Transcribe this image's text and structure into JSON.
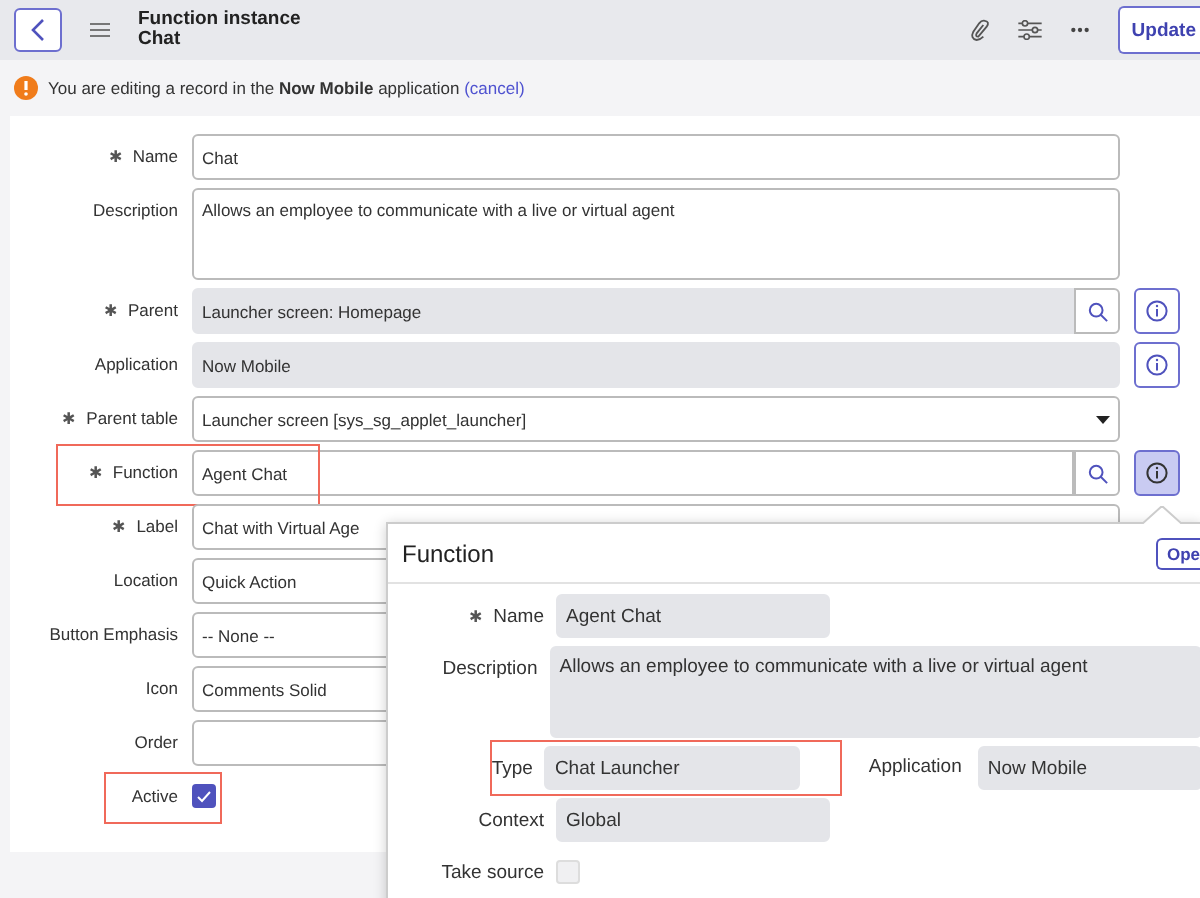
{
  "header": {
    "title": "Function instance",
    "subtitle": "Chat",
    "update_button": "Update"
  },
  "notice": {
    "before": "You are editing a record in the",
    "app": "Now Mobile",
    "after": "application",
    "link": "(cancel)"
  },
  "form": {
    "rows": [
      {
        "label": "Name",
        "marker": "✱",
        "kind": "text",
        "value": "Chat",
        "highlighted": false
      },
      {
        "label": "Description",
        "kind": "textarea",
        "value": "Allows an employee to communicate with a live or virtual agent",
        "highlighted": false
      },
      {
        "label": "Parent",
        "marker": "✱",
        "kind": "reference-readonly",
        "value": "Launcher screen: Homepage",
        "info_button": {
          "pressed": false
        },
        "highlighted": false
      },
      {
        "label": "Application",
        "kind": "readonly",
        "value": "Now Mobile",
        "info_button": {
          "pressed": false
        },
        "highlighted": false
      },
      {
        "label": "Parent table",
        "marker": "✱",
        "kind": "select",
        "value": "Launcher screen [sys_sg_applet_launcher]",
        "highlighted": false
      },
      {
        "label": "Function",
        "marker": "✱",
        "kind": "reference",
        "value": "Agent Chat",
        "info_button": {
          "pressed": true
        },
        "highlighted": true
      },
      {
        "label": "Label",
        "marker": "✱",
        "kind": "text",
        "value": "Chat with Virtual Age",
        "highlighted": false
      },
      {
        "label": "Location",
        "kind": "text",
        "value": "Quick Action",
        "highlighted": false
      },
      {
        "label": "Button Emphasis",
        "kind": "text",
        "value": "-- None --",
        "highlighted": false
      },
      {
        "label": "Icon",
        "kind": "text",
        "value": "Comments Solid",
        "highlighted": false
      },
      {
        "label": "Order",
        "kind": "text",
        "value": "",
        "highlighted": false
      },
      {
        "label": "Active",
        "kind": "checkbox",
        "checked": true,
        "highlighted": true
      }
    ]
  },
  "popup": {
    "title": "Function",
    "open_button": "Ope",
    "fields": [
      {
        "label": "Name",
        "marker": "✱",
        "kind": "short",
        "value": "Agent Chat",
        "highlighted": false
      },
      {
        "label": "Description",
        "kind": "textarea",
        "value": "Allows an employee to communicate with a live or virtual agent",
        "highlighted": false
      },
      {
        "label": "Type",
        "kind": "short",
        "value": "Chat Launcher",
        "highlighted": true,
        "side_label": "Application",
        "side_value": "Now Mobile"
      },
      {
        "label": "Context",
        "kind": "short",
        "value": "Global",
        "highlighted": false
      },
      {
        "label": "Take source",
        "kind": "checkbox",
        "checked": false,
        "highlighted": false
      }
    ]
  }
}
